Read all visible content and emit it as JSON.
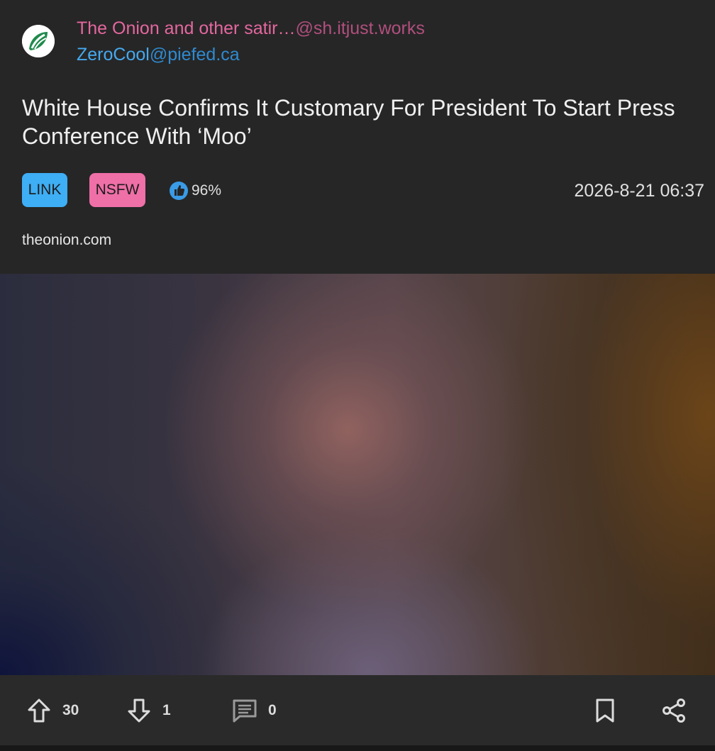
{
  "community": {
    "name": "The Onion and other satir…",
    "instance": "@sh.itjust.works"
  },
  "author": {
    "name": "ZeroCool",
    "instance": "@piefed.ca"
  },
  "post": {
    "title": "White House Confirms It Customary For President To Start Press Conference With ‘Moo’",
    "badges": {
      "link": "LINK",
      "nsfw": "NSFW"
    },
    "score": "96%",
    "date": "2026-8-21 06:37",
    "domain": "theonion.com"
  },
  "actions": {
    "upvotes": "30",
    "downvotes": "1",
    "comments": "0"
  },
  "icons": {
    "avatar": "onion-logo-icon",
    "score": "thumbs-up-icon",
    "upvote": "arrow-up-icon",
    "downvote": "arrow-down-icon",
    "comments": "comment-icon",
    "bookmark": "bookmark-icon",
    "share": "share-icon"
  },
  "colors": {
    "community": "#e4679f",
    "author": "#45a9f0",
    "link_badge": "#3eaef5",
    "nsfw_badge": "#ef6fa7",
    "background": "#262626"
  }
}
